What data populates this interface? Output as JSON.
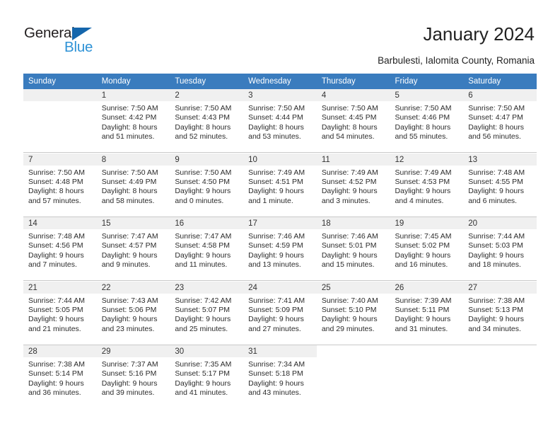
{
  "logo": {
    "word1": "General",
    "word2": "Blue",
    "triangle_color": "#1566ac",
    "word2_color": "#2e92d6"
  },
  "header": {
    "title": "January 2024",
    "subtitle": "Barbulesti, Ialomita County, Romania"
  },
  "calendar": {
    "header_bg": "#3a7cbe",
    "daynum_bg": "#f0f0f0",
    "weekday_headers": [
      "Sunday",
      "Monday",
      "Tuesday",
      "Wednesday",
      "Thursday",
      "Friday",
      "Saturday"
    ],
    "weeks": [
      [
        {
          "day": "",
          "sunrise": "",
          "sunset": "",
          "daylight1": "",
          "daylight2": ""
        },
        {
          "day": "1",
          "sunrise": "Sunrise: 7:50 AM",
          "sunset": "Sunset: 4:42 PM",
          "daylight1": "Daylight: 8 hours",
          "daylight2": "and 51 minutes."
        },
        {
          "day": "2",
          "sunrise": "Sunrise: 7:50 AM",
          "sunset": "Sunset: 4:43 PM",
          "daylight1": "Daylight: 8 hours",
          "daylight2": "and 52 minutes."
        },
        {
          "day": "3",
          "sunrise": "Sunrise: 7:50 AM",
          "sunset": "Sunset: 4:44 PM",
          "daylight1": "Daylight: 8 hours",
          "daylight2": "and 53 minutes."
        },
        {
          "day": "4",
          "sunrise": "Sunrise: 7:50 AM",
          "sunset": "Sunset: 4:45 PM",
          "daylight1": "Daylight: 8 hours",
          "daylight2": "and 54 minutes."
        },
        {
          "day": "5",
          "sunrise": "Sunrise: 7:50 AM",
          "sunset": "Sunset: 4:46 PM",
          "daylight1": "Daylight: 8 hours",
          "daylight2": "and 55 minutes."
        },
        {
          "day": "6",
          "sunrise": "Sunrise: 7:50 AM",
          "sunset": "Sunset: 4:47 PM",
          "daylight1": "Daylight: 8 hours",
          "daylight2": "and 56 minutes."
        }
      ],
      [
        {
          "day": "7",
          "sunrise": "Sunrise: 7:50 AM",
          "sunset": "Sunset: 4:48 PM",
          "daylight1": "Daylight: 8 hours",
          "daylight2": "and 57 minutes."
        },
        {
          "day": "8",
          "sunrise": "Sunrise: 7:50 AM",
          "sunset": "Sunset: 4:49 PM",
          "daylight1": "Daylight: 8 hours",
          "daylight2": "and 58 minutes."
        },
        {
          "day": "9",
          "sunrise": "Sunrise: 7:50 AM",
          "sunset": "Sunset: 4:50 PM",
          "daylight1": "Daylight: 9 hours",
          "daylight2": "and 0 minutes."
        },
        {
          "day": "10",
          "sunrise": "Sunrise: 7:49 AM",
          "sunset": "Sunset: 4:51 PM",
          "daylight1": "Daylight: 9 hours",
          "daylight2": "and 1 minute."
        },
        {
          "day": "11",
          "sunrise": "Sunrise: 7:49 AM",
          "sunset": "Sunset: 4:52 PM",
          "daylight1": "Daylight: 9 hours",
          "daylight2": "and 3 minutes."
        },
        {
          "day": "12",
          "sunrise": "Sunrise: 7:49 AM",
          "sunset": "Sunset: 4:53 PM",
          "daylight1": "Daylight: 9 hours",
          "daylight2": "and 4 minutes."
        },
        {
          "day": "13",
          "sunrise": "Sunrise: 7:48 AM",
          "sunset": "Sunset: 4:55 PM",
          "daylight1": "Daylight: 9 hours",
          "daylight2": "and 6 minutes."
        }
      ],
      [
        {
          "day": "14",
          "sunrise": "Sunrise: 7:48 AM",
          "sunset": "Sunset: 4:56 PM",
          "daylight1": "Daylight: 9 hours",
          "daylight2": "and 7 minutes."
        },
        {
          "day": "15",
          "sunrise": "Sunrise: 7:47 AM",
          "sunset": "Sunset: 4:57 PM",
          "daylight1": "Daylight: 9 hours",
          "daylight2": "and 9 minutes."
        },
        {
          "day": "16",
          "sunrise": "Sunrise: 7:47 AM",
          "sunset": "Sunset: 4:58 PM",
          "daylight1": "Daylight: 9 hours",
          "daylight2": "and 11 minutes."
        },
        {
          "day": "17",
          "sunrise": "Sunrise: 7:46 AM",
          "sunset": "Sunset: 4:59 PM",
          "daylight1": "Daylight: 9 hours",
          "daylight2": "and 13 minutes."
        },
        {
          "day": "18",
          "sunrise": "Sunrise: 7:46 AM",
          "sunset": "Sunset: 5:01 PM",
          "daylight1": "Daylight: 9 hours",
          "daylight2": "and 15 minutes."
        },
        {
          "day": "19",
          "sunrise": "Sunrise: 7:45 AM",
          "sunset": "Sunset: 5:02 PM",
          "daylight1": "Daylight: 9 hours",
          "daylight2": "and 16 minutes."
        },
        {
          "day": "20",
          "sunrise": "Sunrise: 7:44 AM",
          "sunset": "Sunset: 5:03 PM",
          "daylight1": "Daylight: 9 hours",
          "daylight2": "and 18 minutes."
        }
      ],
      [
        {
          "day": "21",
          "sunrise": "Sunrise: 7:44 AM",
          "sunset": "Sunset: 5:05 PM",
          "daylight1": "Daylight: 9 hours",
          "daylight2": "and 21 minutes."
        },
        {
          "day": "22",
          "sunrise": "Sunrise: 7:43 AM",
          "sunset": "Sunset: 5:06 PM",
          "daylight1": "Daylight: 9 hours",
          "daylight2": "and 23 minutes."
        },
        {
          "day": "23",
          "sunrise": "Sunrise: 7:42 AM",
          "sunset": "Sunset: 5:07 PM",
          "daylight1": "Daylight: 9 hours",
          "daylight2": "and 25 minutes."
        },
        {
          "day": "24",
          "sunrise": "Sunrise: 7:41 AM",
          "sunset": "Sunset: 5:09 PM",
          "daylight1": "Daylight: 9 hours",
          "daylight2": "and 27 minutes."
        },
        {
          "day": "25",
          "sunrise": "Sunrise: 7:40 AM",
          "sunset": "Sunset: 5:10 PM",
          "daylight1": "Daylight: 9 hours",
          "daylight2": "and 29 minutes."
        },
        {
          "day": "26",
          "sunrise": "Sunrise: 7:39 AM",
          "sunset": "Sunset: 5:11 PM",
          "daylight1": "Daylight: 9 hours",
          "daylight2": "and 31 minutes."
        },
        {
          "day": "27",
          "sunrise": "Sunrise: 7:38 AM",
          "sunset": "Sunset: 5:13 PM",
          "daylight1": "Daylight: 9 hours",
          "daylight2": "and 34 minutes."
        }
      ],
      [
        {
          "day": "28",
          "sunrise": "Sunrise: 7:38 AM",
          "sunset": "Sunset: 5:14 PM",
          "daylight1": "Daylight: 9 hours",
          "daylight2": "and 36 minutes."
        },
        {
          "day": "29",
          "sunrise": "Sunrise: 7:37 AM",
          "sunset": "Sunset: 5:16 PM",
          "daylight1": "Daylight: 9 hours",
          "daylight2": "and 39 minutes."
        },
        {
          "day": "30",
          "sunrise": "Sunrise: 7:35 AM",
          "sunset": "Sunset: 5:17 PM",
          "daylight1": "Daylight: 9 hours",
          "daylight2": "and 41 minutes."
        },
        {
          "day": "31",
          "sunrise": "Sunrise: 7:34 AM",
          "sunset": "Sunset: 5:18 PM",
          "daylight1": "Daylight: 9 hours",
          "daylight2": "and 43 minutes."
        },
        {
          "day": "",
          "sunrise": "",
          "sunset": "",
          "daylight1": "",
          "daylight2": ""
        },
        {
          "day": "",
          "sunrise": "",
          "sunset": "",
          "daylight1": "",
          "daylight2": ""
        },
        {
          "day": "",
          "sunrise": "",
          "sunset": "",
          "daylight1": "",
          "daylight2": ""
        }
      ]
    ]
  }
}
